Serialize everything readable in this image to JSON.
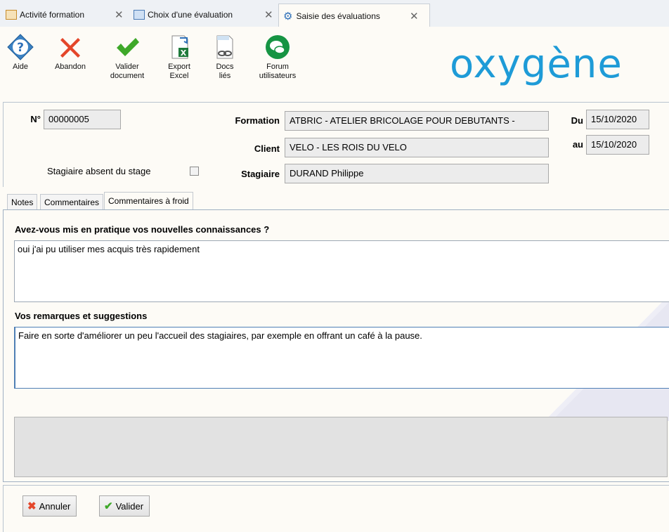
{
  "tabs": [
    {
      "label": "Activité formation",
      "icon": "training-icon"
    },
    {
      "label": "Choix d'une évaluation",
      "icon": "list-icon"
    },
    {
      "label": "Saisie des évaluations",
      "icon": "gears-icon"
    }
  ],
  "toolbar": {
    "help": "Aide",
    "abort": "Abandon",
    "validate_line1": "Valider",
    "validate_line2": "document",
    "export_line1": "Export",
    "export_line2": "Excel",
    "docs_line1": "Docs",
    "docs_line2": "liés",
    "forum_line1": "Forum",
    "forum_line2": "utilisateurs"
  },
  "logo": "oxygène",
  "header": {
    "num_label": "N°",
    "num_value": "00000005",
    "formation_label": "Formation",
    "formation_value": "ATBRIC - ATELIER BRICOLAGE POUR DEBUTANTS -",
    "client_label": "Client",
    "client_value": "VELO - LES ROIS DU VELO",
    "stagiaire_label": "Stagiaire",
    "stagiaire_value": "DURAND Philippe",
    "absent_label": "Stagiaire absent du stage",
    "absent_checked": false,
    "du_label": "Du",
    "du_value": "15/10/2020",
    "au_label": "au",
    "au_value": "15/10/2020"
  },
  "inner_tabs": [
    "Notes",
    "Commentaires",
    "Commentaires à froid"
  ],
  "form": {
    "q1": "Avez-vous mis en pratique vos nouvelles connaissances ?",
    "a1": "oui j'ai pu utiliser mes acquis très rapidement",
    "q2": "Vos remarques et suggestions",
    "a2": "Faire en sorte d'améliorer un peu l'accueil des stagiaires, par exemple en offrant un café à la pause."
  },
  "buttons": {
    "cancel": "Annuler",
    "ok": "Valider"
  },
  "colors": {
    "accent": "#1e9bd7",
    "cancel_icon": "#e4462a",
    "ok_icon": "#3ea829"
  }
}
